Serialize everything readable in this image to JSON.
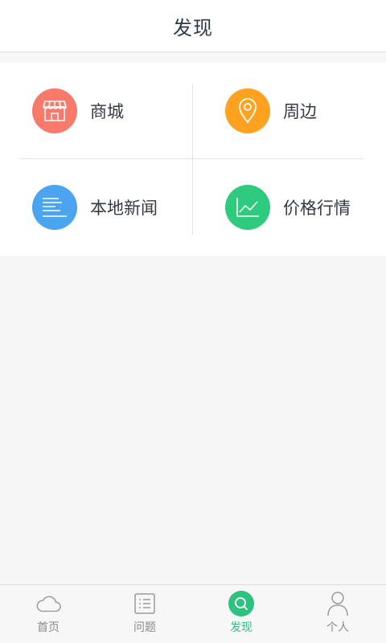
{
  "header": {
    "title": "发现"
  },
  "colors": {
    "mall": "#f97a6b",
    "nearby": "#ffa21f",
    "news": "#4aa4f0",
    "price": "#2ecb7f",
    "tab_active": "#2ec27e",
    "tab_inactive": "#8a8a8a"
  },
  "grid": {
    "items": [
      {
        "label": "商城",
        "icon": "store-icon"
      },
      {
        "label": "周边",
        "icon": "location-pin-icon"
      },
      {
        "label": "本地新闻",
        "icon": "news-lines-icon"
      },
      {
        "label": "价格行情",
        "icon": "line-chart-icon"
      }
    ]
  },
  "tabbar": {
    "tabs": [
      {
        "label": "首页",
        "icon": "cloud-icon",
        "active": false
      },
      {
        "label": "问题",
        "icon": "list-icon",
        "active": false
      },
      {
        "label": "发现",
        "icon": "search-icon",
        "active": true
      },
      {
        "label": "个人",
        "icon": "person-icon",
        "active": false
      }
    ]
  }
}
